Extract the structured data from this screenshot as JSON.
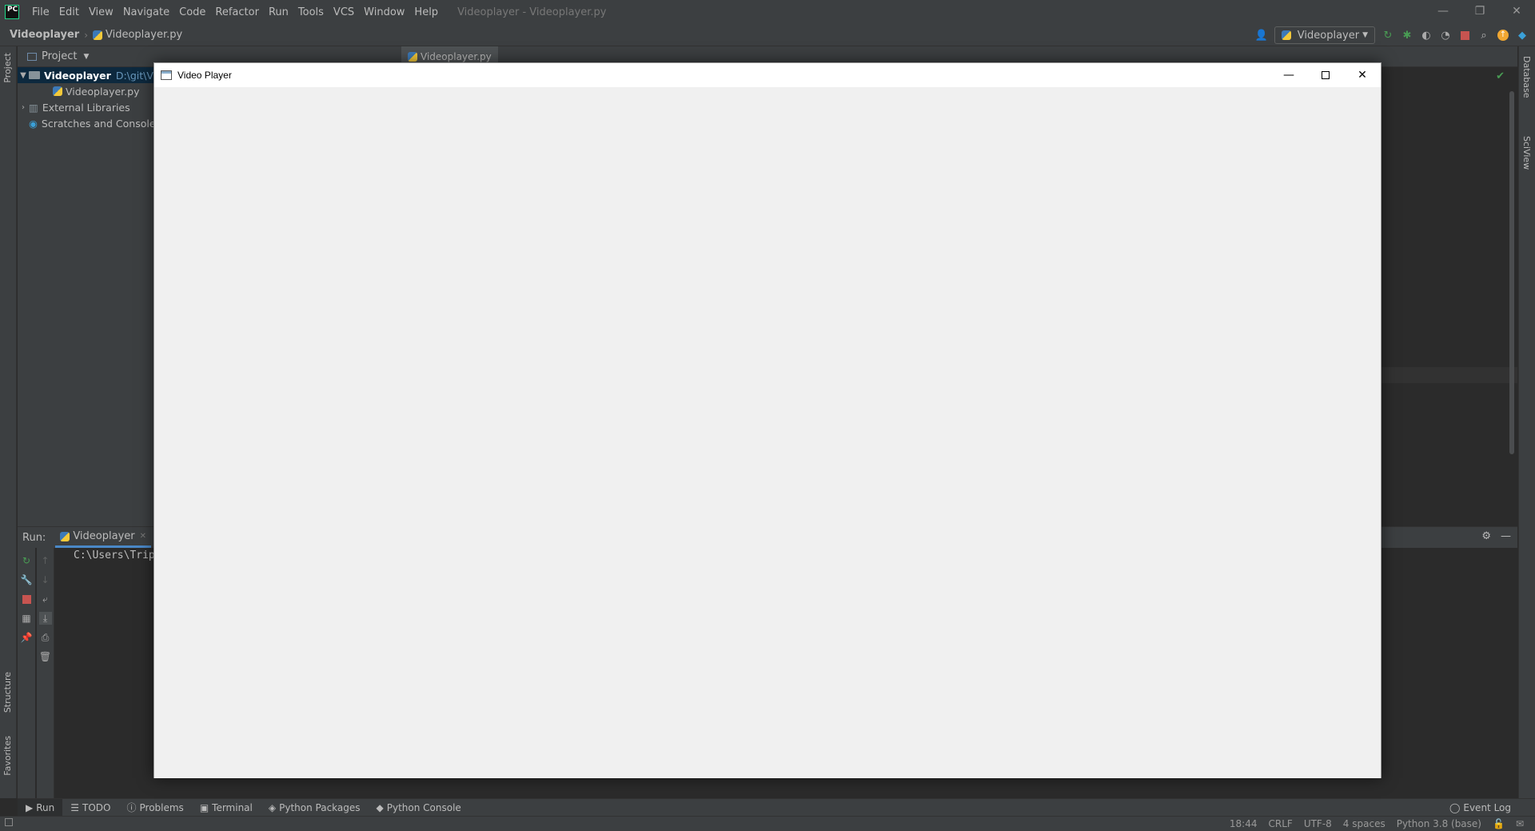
{
  "ide": {
    "logo": "PC",
    "menu": [
      "File",
      "Edit",
      "View",
      "Navigate",
      "Code",
      "Refactor",
      "Run",
      "Tools",
      "VCS",
      "Window",
      "Help"
    ],
    "window_title": "Videoplayer - Videoplayer.py",
    "breadcrumb": {
      "project": "Videoplayer",
      "file": "Videoplayer.py"
    },
    "run_config": "Videoplayer",
    "left_tabs": {
      "project": "Project",
      "structure": "Structure",
      "favorites": "Favorites"
    },
    "right_tabs": {
      "database": "Database",
      "sciview": "SciView"
    },
    "colors": {
      "background": "#2b2b2b",
      "panel": "#3c3f41",
      "accent": "#4a88c7",
      "run_green": "#499c54",
      "stop_red": "#c75450"
    }
  },
  "project_panel": {
    "title": "Project",
    "tree": [
      {
        "label": "Videoplayer",
        "path": "D:\\git\\V",
        "level": 0,
        "expanded": true,
        "selected": true
      },
      {
        "label": "Videoplayer.py",
        "level": 1
      },
      {
        "label": "External Libraries",
        "level": 0,
        "expanded": false
      },
      {
        "label": "Scratches and Consoles",
        "level": 0
      }
    ]
  },
  "editor": {
    "tab_label": "Videoplayer.py"
  },
  "run_panel": {
    "label": "Run:",
    "tab_label": "Videoplayer",
    "console_text": "C:\\Users\\Trip"
  },
  "bottom_tools": {
    "run": "Run",
    "todo": "TODO",
    "problems": "Problems",
    "terminal": "Terminal",
    "python_packages": "Python Packages",
    "python_console": "Python Console",
    "event_log": "Event Log"
  },
  "status_bar": {
    "position": "18:44",
    "line_sep": "CRLF",
    "encoding": "UTF-8",
    "indent": "4 spaces",
    "interpreter": "Python 3.8 (base)"
  },
  "video_player": {
    "title": "Video Player"
  }
}
